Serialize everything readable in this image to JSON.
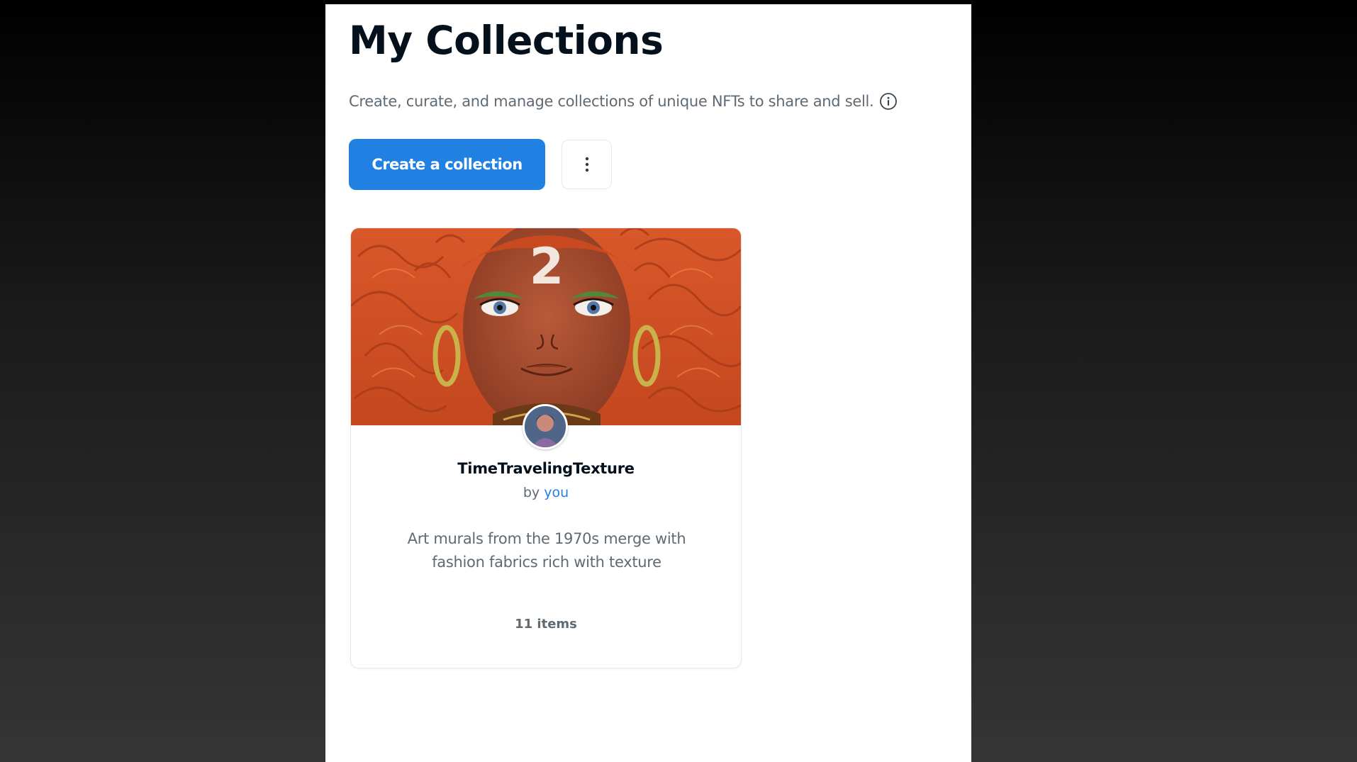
{
  "page": {
    "title": "My Collections",
    "subtitle": "Create, curate, and manage collections of unique NFTs to share and sell."
  },
  "actions": {
    "create_label": "Create a collection",
    "more_icon": "more-vertical-icon"
  },
  "colors": {
    "accent": "#2081e2",
    "text_primary": "#04111d",
    "text_secondary": "#5f6a73",
    "border": "#e5e8eb"
  },
  "collections": [
    {
      "name": "TimeTravelingTexture",
      "owner_prefix": "by",
      "owner": "you",
      "description": "Art murals from the 1970s merge with fashion fabrics rich with texture",
      "items": "11 items",
      "banner_text": "2"
    }
  ]
}
